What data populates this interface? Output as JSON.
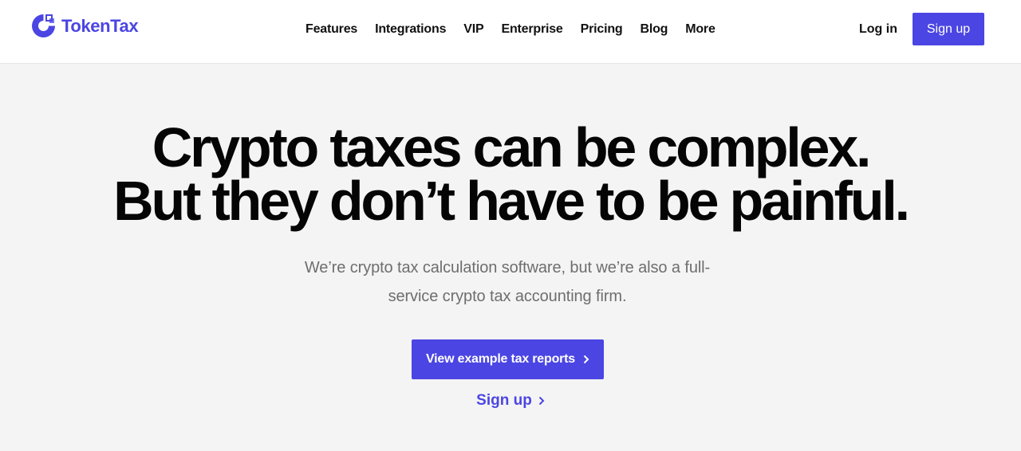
{
  "brand": {
    "name": "TokenTax",
    "color": "#4b45e3"
  },
  "nav": {
    "items": [
      {
        "label": "Features"
      },
      {
        "label": "Integrations"
      },
      {
        "label": "VIP"
      },
      {
        "label": "Enterprise"
      },
      {
        "label": "Pricing"
      },
      {
        "label": "Blog"
      },
      {
        "label": "More"
      }
    ],
    "login_label": "Log in",
    "signup_label": "Sign up"
  },
  "hero": {
    "headline_line1": "Crypto taxes can be complex.",
    "headline_line2": "But they don’t have to be painful.",
    "subtext": "We’re crypto tax calculation software, but we’re also a full-service crypto tax accounting firm.",
    "cta_label": "View example tax reports",
    "cta_icon": "chevron-right-icon",
    "secondary_label": "Sign up",
    "secondary_icon": "chevron-right-icon"
  }
}
